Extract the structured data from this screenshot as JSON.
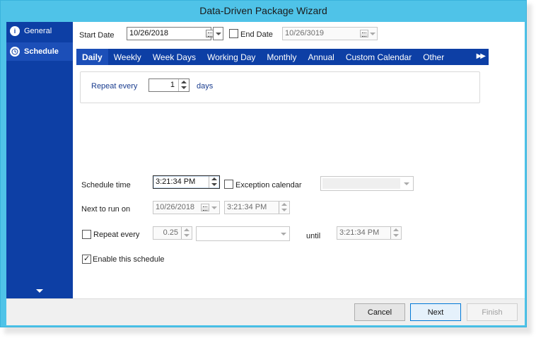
{
  "window": {
    "title": "Data-Driven Package Wizard"
  },
  "sidebar": {
    "items": [
      {
        "label": "General",
        "icon": "info-icon"
      },
      {
        "label": "Schedule",
        "icon": "clock-icon"
      }
    ]
  },
  "header": {
    "start_date_label": "Start Date",
    "start_date_value": "10/26/2018",
    "end_date_label": "End Date",
    "end_date_value": "10/26/3019",
    "end_date_checked": false
  },
  "tabs": [
    "Daily",
    "Weekly",
    "Week Days",
    "Working Day",
    "Monthly",
    "Annual",
    "Custom Calendar",
    "Other"
  ],
  "active_tab": "Daily",
  "daily": {
    "repeat_label": "Repeat every",
    "repeat_value": "1",
    "repeat_unit": "days"
  },
  "schedule": {
    "schedule_time_label": "Schedule time",
    "schedule_time_value": "3:21:34 PM",
    "exception_label": "Exception calendar",
    "exception_checked": false,
    "exception_value": "",
    "next_run_label": "Next to run on",
    "next_run_date": "10/26/2018",
    "next_run_time": "3:21:34 PM",
    "repeat_every_label": "Repeat every",
    "repeat_every_checked": false,
    "repeat_every_value": "0.25",
    "repeat_unit_value": "",
    "until_label": "until",
    "until_value": "3:21:34 PM",
    "enable_label": "Enable this schedule",
    "enable_checked": true
  },
  "footer": {
    "cancel_label": "Cancel",
    "next_label": "Next",
    "finish_label": "Finish"
  },
  "colors": {
    "title_bar": "#4fc3e8",
    "nav_blue": "#0d3fa5"
  }
}
